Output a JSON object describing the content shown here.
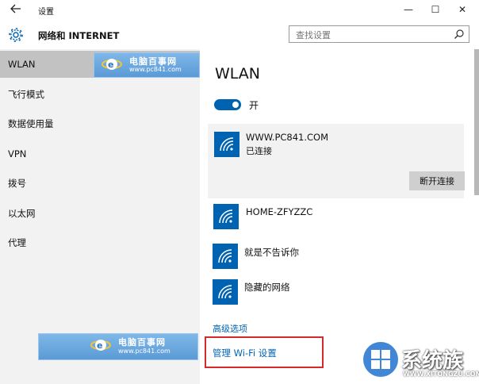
{
  "titlebar": {
    "back_icon": "back-arrow-icon",
    "title": "设置",
    "minimize": "—",
    "maximize": "☐",
    "close": "✕"
  },
  "header": {
    "icon": "gear-icon",
    "title": "网络和 INTERNET",
    "search": {
      "placeholder": "查找设置",
      "value": ""
    }
  },
  "sidebar": {
    "items": [
      {
        "label": "WLAN",
        "active": true
      },
      {
        "label": "飞行模式"
      },
      {
        "label": "数据使用量"
      },
      {
        "label": "VPN"
      },
      {
        "label": "拨号"
      },
      {
        "label": "以太网"
      },
      {
        "label": "代理"
      }
    ],
    "watermark": {
      "name": "电脑百事网",
      "url": "www.pc841.com"
    }
  },
  "main": {
    "title": "WLAN",
    "toggle": {
      "label": "开",
      "on": true
    },
    "connected": {
      "name": "WWW.PC841.COM",
      "status": "已连接",
      "button": "断开连接"
    },
    "networks": [
      {
        "name": "HOME-ZFYZZC"
      },
      {
        "name": "就是不告诉你"
      },
      {
        "name": "隐藏的网络"
      }
    ],
    "advanced_link": "高级选项",
    "manage_link": "管理 Wi-Fi 设置"
  },
  "watermark_corner": {
    "brand": "系统族",
    "url": "WWW.XITONGZU.COM"
  },
  "colors": {
    "accent": "#0063b1",
    "sidebar_bg": "#f2f2f2",
    "selected_bg": "#c2c2c2",
    "highlight_box": "#d42a2a"
  }
}
